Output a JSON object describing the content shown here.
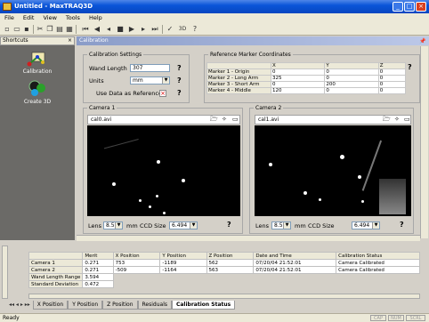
{
  "window": {
    "title": "Untitled - MaxTRAQ3D"
  },
  "menu": [
    "File",
    "Edit",
    "View",
    "Tools",
    "Help"
  ],
  "shortcuts": {
    "header": "Shortcuts",
    "items": [
      {
        "label": "Calibration",
        "icon": "calibration-icon"
      },
      {
        "label": "Create 3D",
        "icon": "create-3d-icon"
      }
    ]
  },
  "panel": {
    "title": "Calibration"
  },
  "calibration_settings": {
    "legend": "Calibration Settings",
    "wand_length_label": "Wand Length",
    "wand_length_value": "307",
    "units_label": "Units",
    "units_value": "mm",
    "reference_button": "Use Data as Reference"
  },
  "marker_coords": {
    "legend": "Reference Marker Coordinates",
    "columns": [
      "X",
      "Y",
      "Z"
    ],
    "rows": [
      {
        "name": "Marker 1 - Origin",
        "x": "0",
        "y": "0",
        "z": "0"
      },
      {
        "name": "Marker 2 - Long Arm",
        "x": "325",
        "y": "0",
        "z": "0"
      },
      {
        "name": "Marker 3 - Short Arm",
        "x": "0",
        "y": "200",
        "z": "0"
      },
      {
        "name": "Marker 4 - Middle",
        "x": "120",
        "y": "0",
        "z": "0"
      }
    ]
  },
  "camera1": {
    "legend": "Camera 1",
    "file": "cal0.avi",
    "lens_label": "Lens",
    "lens_value": "8.5",
    "mm": "mm",
    "ccd_label": "CCD Size",
    "ccd_value": "6.494"
  },
  "camera2": {
    "legend": "Camera 2",
    "file": "cal1.avi",
    "lens_label": "Lens",
    "lens_value": "8.5",
    "mm": "mm",
    "ccd_label": "CCD Size",
    "ccd_value": "6.494"
  },
  "results": {
    "columns": [
      "Merit",
      "X Position",
      "Y Position",
      "Z Position",
      "Date and Time",
      "Calibration Status"
    ],
    "rows": [
      {
        "name": "Camera 1",
        "merit": "0.271",
        "x": "753",
        "y": "-1189",
        "z": "562",
        "date": "07/20/04 21:52:01",
        "status": "Camera Calibrated"
      },
      {
        "name": "Camera 2",
        "merit": "0.271",
        "x": "-509",
        "y": "-1164",
        "z": "563",
        "date": "07/20/04 21:52:01",
        "status": "Camera Calibrated"
      }
    ],
    "wand_range_label": "Wand Length Range",
    "wand_range_value": "3.594",
    "std_label": "Standard Deviation",
    "std_value": "0.472"
  },
  "tabs": [
    "X Position",
    "Y Position",
    "Z Position",
    "Residuals",
    "Calibration Status"
  ],
  "status_bar": {
    "text": "Ready",
    "indicators": [
      "CAP",
      "NUM",
      "SCRL"
    ]
  }
}
